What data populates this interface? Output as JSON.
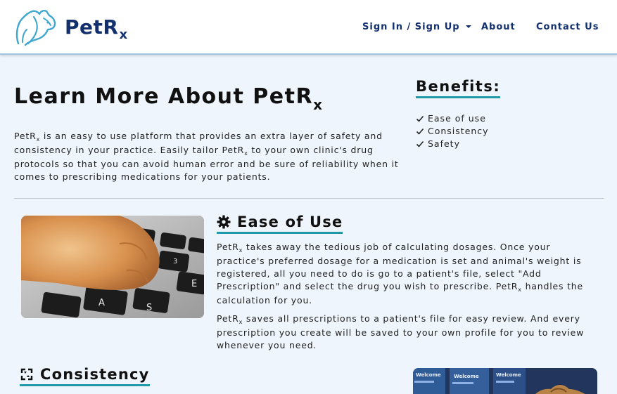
{
  "brand": {
    "name": "PetR",
    "sub": "x"
  },
  "nav": {
    "signin": "Sign In / Sign Up",
    "about": "About",
    "contact": "Contact Us"
  },
  "hero": {
    "title": "Learn More About PetR",
    "title_sub": "x",
    "intro": {
      "part1": "PetR",
      "sub": "x",
      "part2": " is an easy to use platform that provides an extra layer of safety and consistency in your practice. Easily tailor PetR",
      "part3": " to your own clinic's drug protocols so that you can avoid human error and be sure of reliability when it comes to prescribing medications for your patients."
    }
  },
  "benefits": {
    "title": "Benefits:",
    "items": [
      "Ease of use",
      "Consistency",
      "Safety"
    ]
  },
  "ease": {
    "title": "Ease of Use",
    "p1": {
      "a": "PetR",
      "sub": "x",
      "b": " takes away the tedious job of calculating dosages. Once your practice's preferred dosage for a medication is set and animal's weight is registered, all you need to do is go to a patient's file, select \"Add Prescription\" and select the drug you wish to prescribe. PetR",
      "c": " handles the calculation for you."
    },
    "p2": {
      "a": "PetR",
      "sub": "x",
      "b": " saves all prescriptions to a patient's file for easy review. And every prescription you create will be saved to your own profile for you to review whenever you need."
    },
    "photo_keys": [
      "A",
      "S",
      "E",
      "3"
    ]
  },
  "consistency": {
    "title": "Consistency"
  },
  "photo2": {
    "screen_texts": [
      "Welcome",
      "Welcome",
      "Welcome"
    ]
  },
  "colors": {
    "brand": "#12306e",
    "accent": "#1f9aa6",
    "background": "#eef5fc"
  },
  "icons": [
    "dog-cat-logo-icon",
    "caret-down-icon",
    "check-icon",
    "gear-icon",
    "recycle-icon"
  ]
}
